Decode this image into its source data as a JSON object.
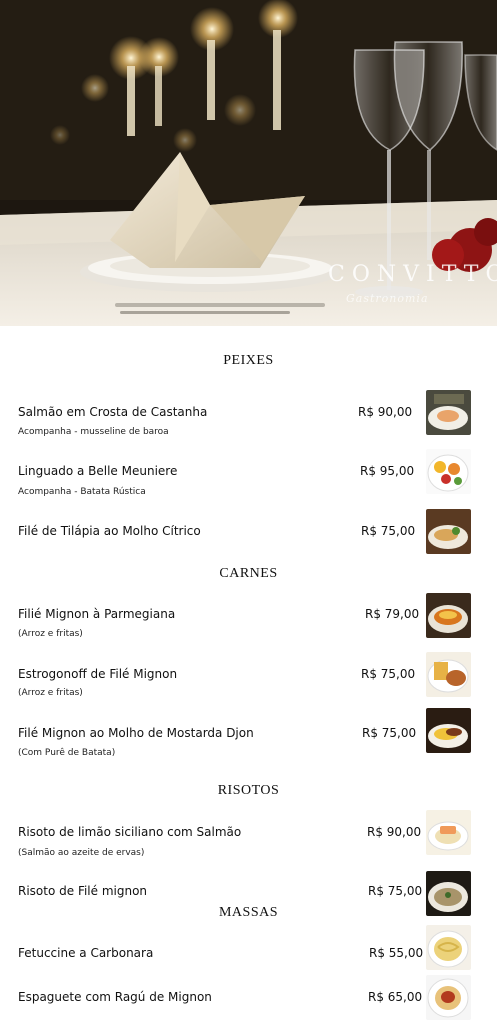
{
  "hero": {
    "image": "restaurant-table-setting",
    "logo_text": "CONVITTO",
    "logo_subtext": "Gastronomia"
  },
  "sections": {
    "peixes": {
      "title": "PEIXES",
      "items": [
        {
          "name": "Salmão em Crosta de Castanha",
          "desc": "Acompanha - musseline de baroa",
          "price": "R$ 90,00",
          "thumb": "salmon-dish"
        },
        {
          "name": "Linguado a Belle Meuniere",
          "desc": "Acompanha - Batata Rústica",
          "price": "R$ 95,00",
          "thumb": "sole-fish-dish"
        },
        {
          "name": "Filé de Tilápia ao Molho Cítrico",
          "price": "R$ 75,00",
          "thumb": "tilapia-dish"
        }
      ]
    },
    "carnes": {
      "title": "CARNES",
      "items": [
        {
          "name": "Filié Mignon à Parmegiana",
          "desc": "(Arroz e fritas)",
          "price": "R$ 79,00",
          "thumb": "parmegiana-dish"
        },
        {
          "name": "Estrogonoff de Filé Mignon",
          "desc": "(Arroz e fritas)",
          "price": "R$ 75,00",
          "thumb": "stroganoff-dish"
        },
        {
          "name": "Filé Mignon ao Molho de Mostarda Djon",
          "desc": "(Com Purê de Batata)",
          "price": "R$ 75,00",
          "thumb": "mustard-steak-dish"
        }
      ]
    },
    "risotos": {
      "title": "RISOTOS",
      "items": [
        {
          "name": "Risoto de limão siciliano com Salmão",
          "desc": "(Salmão ao azeite de ervas)",
          "price": "R$ 90,00",
          "thumb": "lemon-risotto-dish"
        },
        {
          "name": "Risoto de Filé mignon",
          "price": "R$ 75,00",
          "thumb": "beef-risotto-dish"
        }
      ]
    },
    "massas": {
      "title": "MASSAS",
      "items": [
        {
          "name": "Fetuccine a Carbonara",
          "price": "R$ 55,00",
          "thumb": "carbonara-dish"
        },
        {
          "name": "Espaguete com Ragú de Mignon",
          "price": "R$  65,00",
          "thumb": "ragu-spaghetti-dish"
        }
      ]
    }
  },
  "colors": {
    "text": "#111111",
    "background": "#ffffff"
  }
}
